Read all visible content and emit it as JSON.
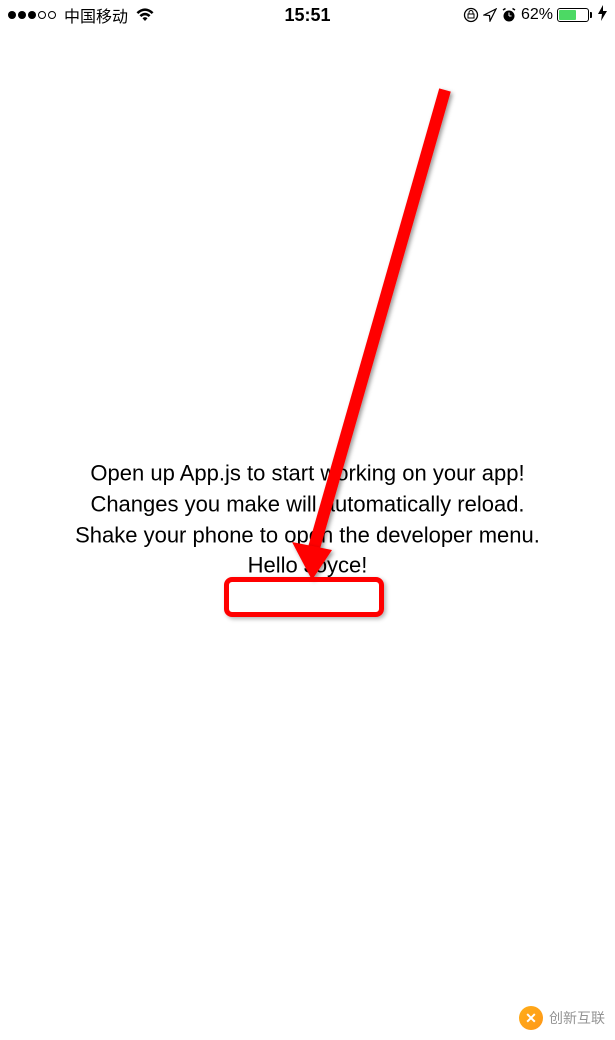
{
  "statusbar": {
    "carrier": "中国移动",
    "time": "15:51",
    "battery_percent": "62%",
    "battery_fill_pct": 62
  },
  "content": {
    "line1": "Open up App.js to start working on your app!",
    "line2": "Changes you make will automatically reload.",
    "line3": "Shake your phone to open the developer menu.",
    "line4": "Hello Joyce!"
  },
  "watermark": {
    "text": "创新互联"
  }
}
